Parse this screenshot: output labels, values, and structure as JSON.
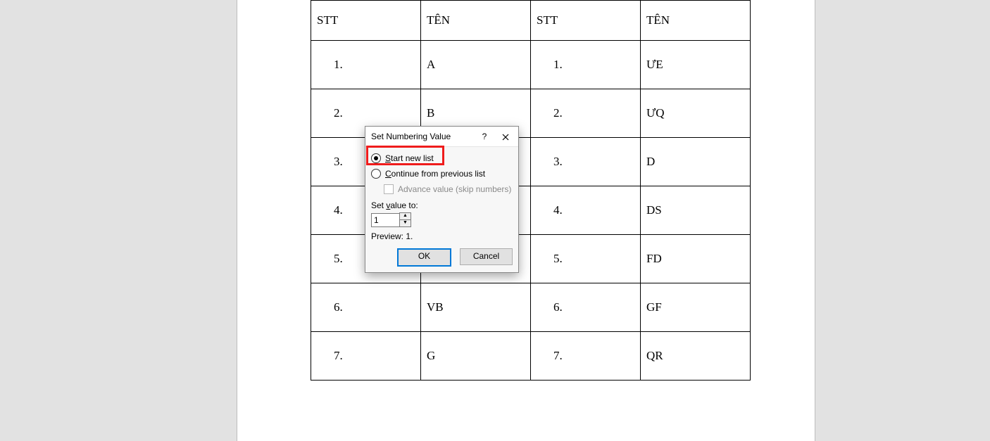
{
  "table": {
    "headers": [
      "STT",
      "TÊN",
      "STT",
      "TÊN"
    ],
    "rows": [
      {
        "n1": "1.",
        "v1": "A",
        "n2": "1.",
        "v2": "ƯE"
      },
      {
        "n1": "2.",
        "v1": "B",
        "n2": "2.",
        "v2": "ƯQ"
      },
      {
        "n1": "3.",
        "v1": "",
        "n2": "3.",
        "v2": "D"
      },
      {
        "n1": "4.",
        "v1": "",
        "n2": "4.",
        "v2": "DS"
      },
      {
        "n1": "5.",
        "v1": "",
        "n2": "5.",
        "v2": "FD"
      },
      {
        "n1": "6.",
        "v1": "VB",
        "n2": "6.",
        "v2": "GF"
      },
      {
        "n1": "7.",
        "v1": "G",
        "n2": "7.",
        "v2": "QR"
      }
    ]
  },
  "dialog": {
    "title": "Set Numbering Value",
    "help": "?",
    "opt_start_prefix": "S",
    "opt_start_rest": "tart new list",
    "opt_cont_prefix": "C",
    "opt_cont_rest": "ontinue from previous list",
    "opt_adv": "Advance value (skip numbers)",
    "setvalue_prefix": "Set ",
    "setvalue_uline": "v",
    "setvalue_rest": "alue to:",
    "value": "1",
    "preview": "Preview: 1.",
    "ok": "OK",
    "cancel": "Cancel"
  }
}
